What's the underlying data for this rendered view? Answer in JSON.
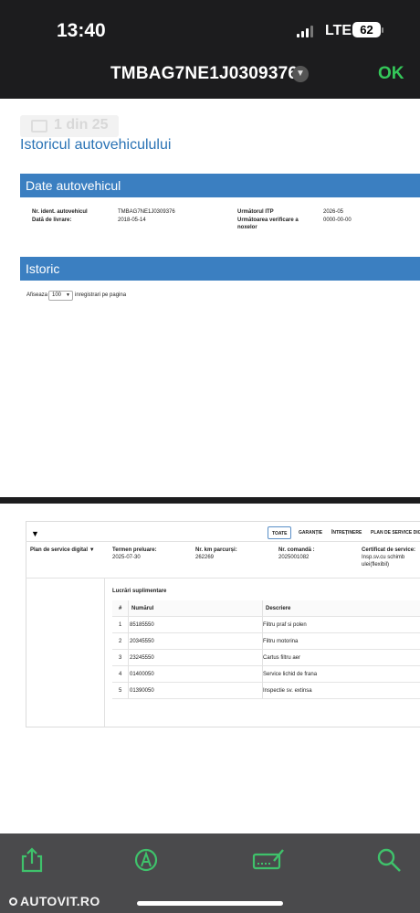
{
  "status_bar": {
    "time": "13:40",
    "network": "LTE",
    "battery": "62"
  },
  "nav": {
    "doc_title": "TMBAG7NE1J0309376",
    "ok_label": "OK"
  },
  "page1": {
    "page_indicator": "1 din 25",
    "heading": "Istoricul autovehiculului",
    "vehicle_section": "Date autovehicul",
    "vin_label": "Nr. ident. autovehicul",
    "vin_value": "TMBAG7NE1J0309376",
    "delivery_label": "Dată de livrare:",
    "delivery_value": "2018-05-14",
    "itp_label": "Următorul ITP",
    "itp_value": "2026-05",
    "noxe_label_1": "Următoarea verificare a",
    "noxe_label_2": "noxelor",
    "noxe_value": "0000-00-00",
    "history_section": "Istoric",
    "show_label": "Afiseaza",
    "show_value": "100",
    "per_page_label": "inregistrari pe pagina"
  },
  "page2": {
    "tabs": [
      "TOATE",
      "GARANȚIE",
      "ÎNTREȚINERE",
      "PLAN DE SERVICE DIGITAL"
    ],
    "active_tab": "TOATE",
    "record_type": "Plan de service digital",
    "term_label": "Termen preluare:",
    "term_value": "2025-07-30",
    "km_label": "Nr. km parcurși:",
    "km_value": "262269",
    "order_label": "Nr. comandă :",
    "order_value": "2025001082",
    "cert_label": "Certificat de service:",
    "cert_value_1": "Insp.sv.cu schimb",
    "cert_value_2": "ulei(flexibil)",
    "extra_works_label": "Lucrări suplimentare",
    "table_headers": [
      "#",
      "Numărul",
      "Descriere"
    ],
    "rows": [
      {
        "n": "1",
        "part": "85185550",
        "desc": "Filtru praf si polen"
      },
      {
        "n": "2",
        "part": "20345550",
        "desc": "Filtru motorina"
      },
      {
        "n": "3",
        "part": "23245550",
        "desc": "Cartus filtru aer"
      },
      {
        "n": "4",
        "part": "01400050",
        "desc": "Service lichid de frana"
      },
      {
        "n": "5",
        "part": "01390050",
        "desc": "Inspectie sv. extinsa"
      }
    ]
  },
  "toolbar": {
    "icons": [
      "share-icon",
      "markup-icon",
      "signature-icon",
      "search-icon"
    ]
  },
  "watermark": "AUTOVIT.RO",
  "colors": {
    "accent_blue": "#3b7fc1",
    "ok_green": "#34c759",
    "dark_bg": "#1c1c1e"
  }
}
